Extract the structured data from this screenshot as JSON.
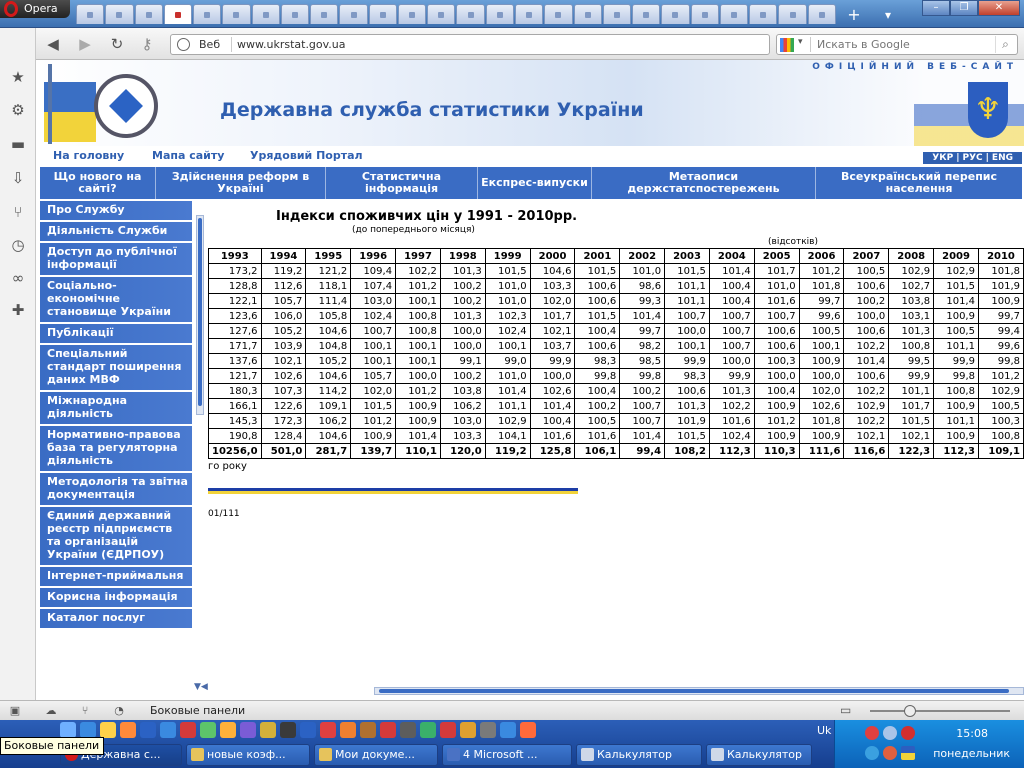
{
  "window": {
    "app_name": "Opera"
  },
  "browser": {
    "address_label": "Веб",
    "url": "www.ukrstat.gov.ua",
    "search_placeholder": "Искать в Google",
    "tab_count": 26
  },
  "site": {
    "official_label": "ОФІЦІЙНИЙ ВЕБ-САЙТ",
    "title": "Державна служба статистики України",
    "top_links": [
      "На головну",
      "Мапа сайту",
      "Урядовий Портал"
    ],
    "languages": [
      "УКР",
      "РУС",
      "ENG"
    ],
    "top_menu": [
      "Що нового на сайті?",
      "Здійснення реформ в Україні",
      "Статистична інформація",
      "Експрес-випуски",
      "Метаописи держстатспостережень",
      "Всеукраїнський перепис населення"
    ],
    "left_nav": [
      "Про Службу",
      "Діяльність Служби",
      "Доступ до публічної інформації",
      "Соціально-економічне становище України",
      "Публікації",
      "Спеціальний стандарт поширення даних МВФ",
      "Міжнародна діяльність",
      "Нормативно-правова база та регуляторна діяльність",
      "Методологія та звітна документація",
      "Єдиний державний реєстр підприємств та організацій України (ЄДРПОУ)",
      "Інтернет-приймальня",
      "Корисна інформація",
      "Каталог послуг"
    ]
  },
  "table": {
    "title": "Індекси споживчих цін у 1991 - 2010рр.",
    "subtitle": "(до попереднього місяця)",
    "unit": "(відсотків)",
    "years": [
      "1993",
      "1994",
      "1995",
      "1996",
      "1997",
      "1998",
      "1999",
      "2000",
      "2001",
      "2002",
      "2003",
      "2004",
      "2005",
      "2006",
      "2007",
      "2008",
      "2009",
      "2010"
    ],
    "rows": [
      [
        "173,2",
        "119,2",
        "121,2",
        "109,4",
        "102,2",
        "101,3",
        "101,5",
        "104,6",
        "101,5",
        "101,0",
        "101,5",
        "101,4",
        "101,7",
        "101,2",
        "100,5",
        "102,9",
        "102,9",
        "101,8"
      ],
      [
        "128,8",
        "112,6",
        "118,1",
        "107,4",
        "101,2",
        "100,2",
        "101,0",
        "103,3",
        "100,6",
        "98,6",
        "101,1",
        "100,4",
        "101,0",
        "101,8",
        "100,6",
        "102,7",
        "101,5",
        "101,9"
      ],
      [
        "122,1",
        "105,7",
        "111,4",
        "103,0",
        "100,1",
        "100,2",
        "101,0",
        "102,0",
        "100,6",
        "99,3",
        "101,1",
        "100,4",
        "101,6",
        "99,7",
        "100,2",
        "103,8",
        "101,4",
        "100,9"
      ],
      [
        "123,6",
        "106,0",
        "105,8",
        "102,4",
        "100,8",
        "101,3",
        "102,3",
        "101,7",
        "101,5",
        "101,4",
        "100,7",
        "100,7",
        "100,7",
        "99,6",
        "100,0",
        "103,1",
        "100,9",
        "99,7"
      ],
      [
        "127,6",
        "105,2",
        "104,6",
        "100,7",
        "100,8",
        "100,0",
        "102,4",
        "102,1",
        "100,4",
        "99,7",
        "100,0",
        "100,7",
        "100,6",
        "100,5",
        "100,6",
        "101,3",
        "100,5",
        "99,4"
      ],
      [
        "171,7",
        "103,9",
        "104,8",
        "100,1",
        "100,1",
        "100,0",
        "100,1",
        "103,7",
        "100,6",
        "98,2",
        "100,1",
        "100,7",
        "100,6",
        "100,1",
        "102,2",
        "100,8",
        "101,1",
        "99,6"
      ],
      [
        "137,6",
        "102,1",
        "105,2",
        "100,1",
        "100,1",
        "99,1",
        "99,0",
        "99,9",
        "98,3",
        "98,5",
        "99,9",
        "100,0",
        "100,3",
        "100,9",
        "101,4",
        "99,5",
        "99,9",
        "99,8"
      ],
      [
        "121,7",
        "102,6",
        "104,6",
        "105,7",
        "100,0",
        "100,2",
        "101,0",
        "100,0",
        "99,8",
        "99,8",
        "98,3",
        "99,9",
        "100,0",
        "100,0",
        "100,6",
        "99,9",
        "99,8",
        "101,2"
      ],
      [
        "180,3",
        "107,3",
        "114,2",
        "102,0",
        "101,2",
        "103,8",
        "101,4",
        "102,6",
        "100,4",
        "100,2",
        "100,6",
        "101,3",
        "100,4",
        "102,0",
        "102,2",
        "101,1",
        "100,8",
        "102,9"
      ],
      [
        "166,1",
        "122,6",
        "109,1",
        "101,5",
        "100,9",
        "106,2",
        "101,1",
        "101,4",
        "100,2",
        "100,7",
        "101,3",
        "102,2",
        "100,9",
        "102,6",
        "102,9",
        "101,7",
        "100,9",
        "100,5"
      ],
      [
        "145,3",
        "172,3",
        "106,2",
        "101,2",
        "100,9",
        "103,0",
        "102,9",
        "100,4",
        "100,5",
        "100,7",
        "101,9",
        "101,6",
        "101,2",
        "101,8",
        "102,2",
        "101,5",
        "101,1",
        "100,3"
      ],
      [
        "190,8",
        "128,4",
        "104,6",
        "100,9",
        "101,4",
        "103,3",
        "104,1",
        "101,6",
        "101,6",
        "101,4",
        "101,5",
        "102,4",
        "100,9",
        "100,9",
        "102,1",
        "102,1",
        "100,9",
        "100,8"
      ]
    ],
    "totals": [
      "10256,0",
      "501,0",
      "281,7",
      "139,7",
      "110,1",
      "120,0",
      "119,2",
      "125,8",
      "106,1",
      "99,4",
      "108,2",
      "112,3",
      "110,3",
      "111,6",
      "116,6",
      "122,3",
      "112,3",
      "109,1"
    ],
    "year_note": "го року",
    "page_code": "01/111"
  },
  "statusbar": {
    "label": "Боковые панели"
  },
  "taskbar": {
    "tasks": [
      "Державна с...",
      "новые коэф...",
      "Мои докуме...",
      "4 Microsoft ...",
      "Калькулятор",
      "Калькулятор"
    ],
    "lang": "Uk",
    "time": "15:08",
    "day": "понедельник"
  },
  "tooltip": {
    "text": "Боковые панели"
  },
  "colors": {
    "accent": "#3a6cc4",
    "flag_blue": "#2c5ec0",
    "flag_yellow": "#f2d33a"
  }
}
